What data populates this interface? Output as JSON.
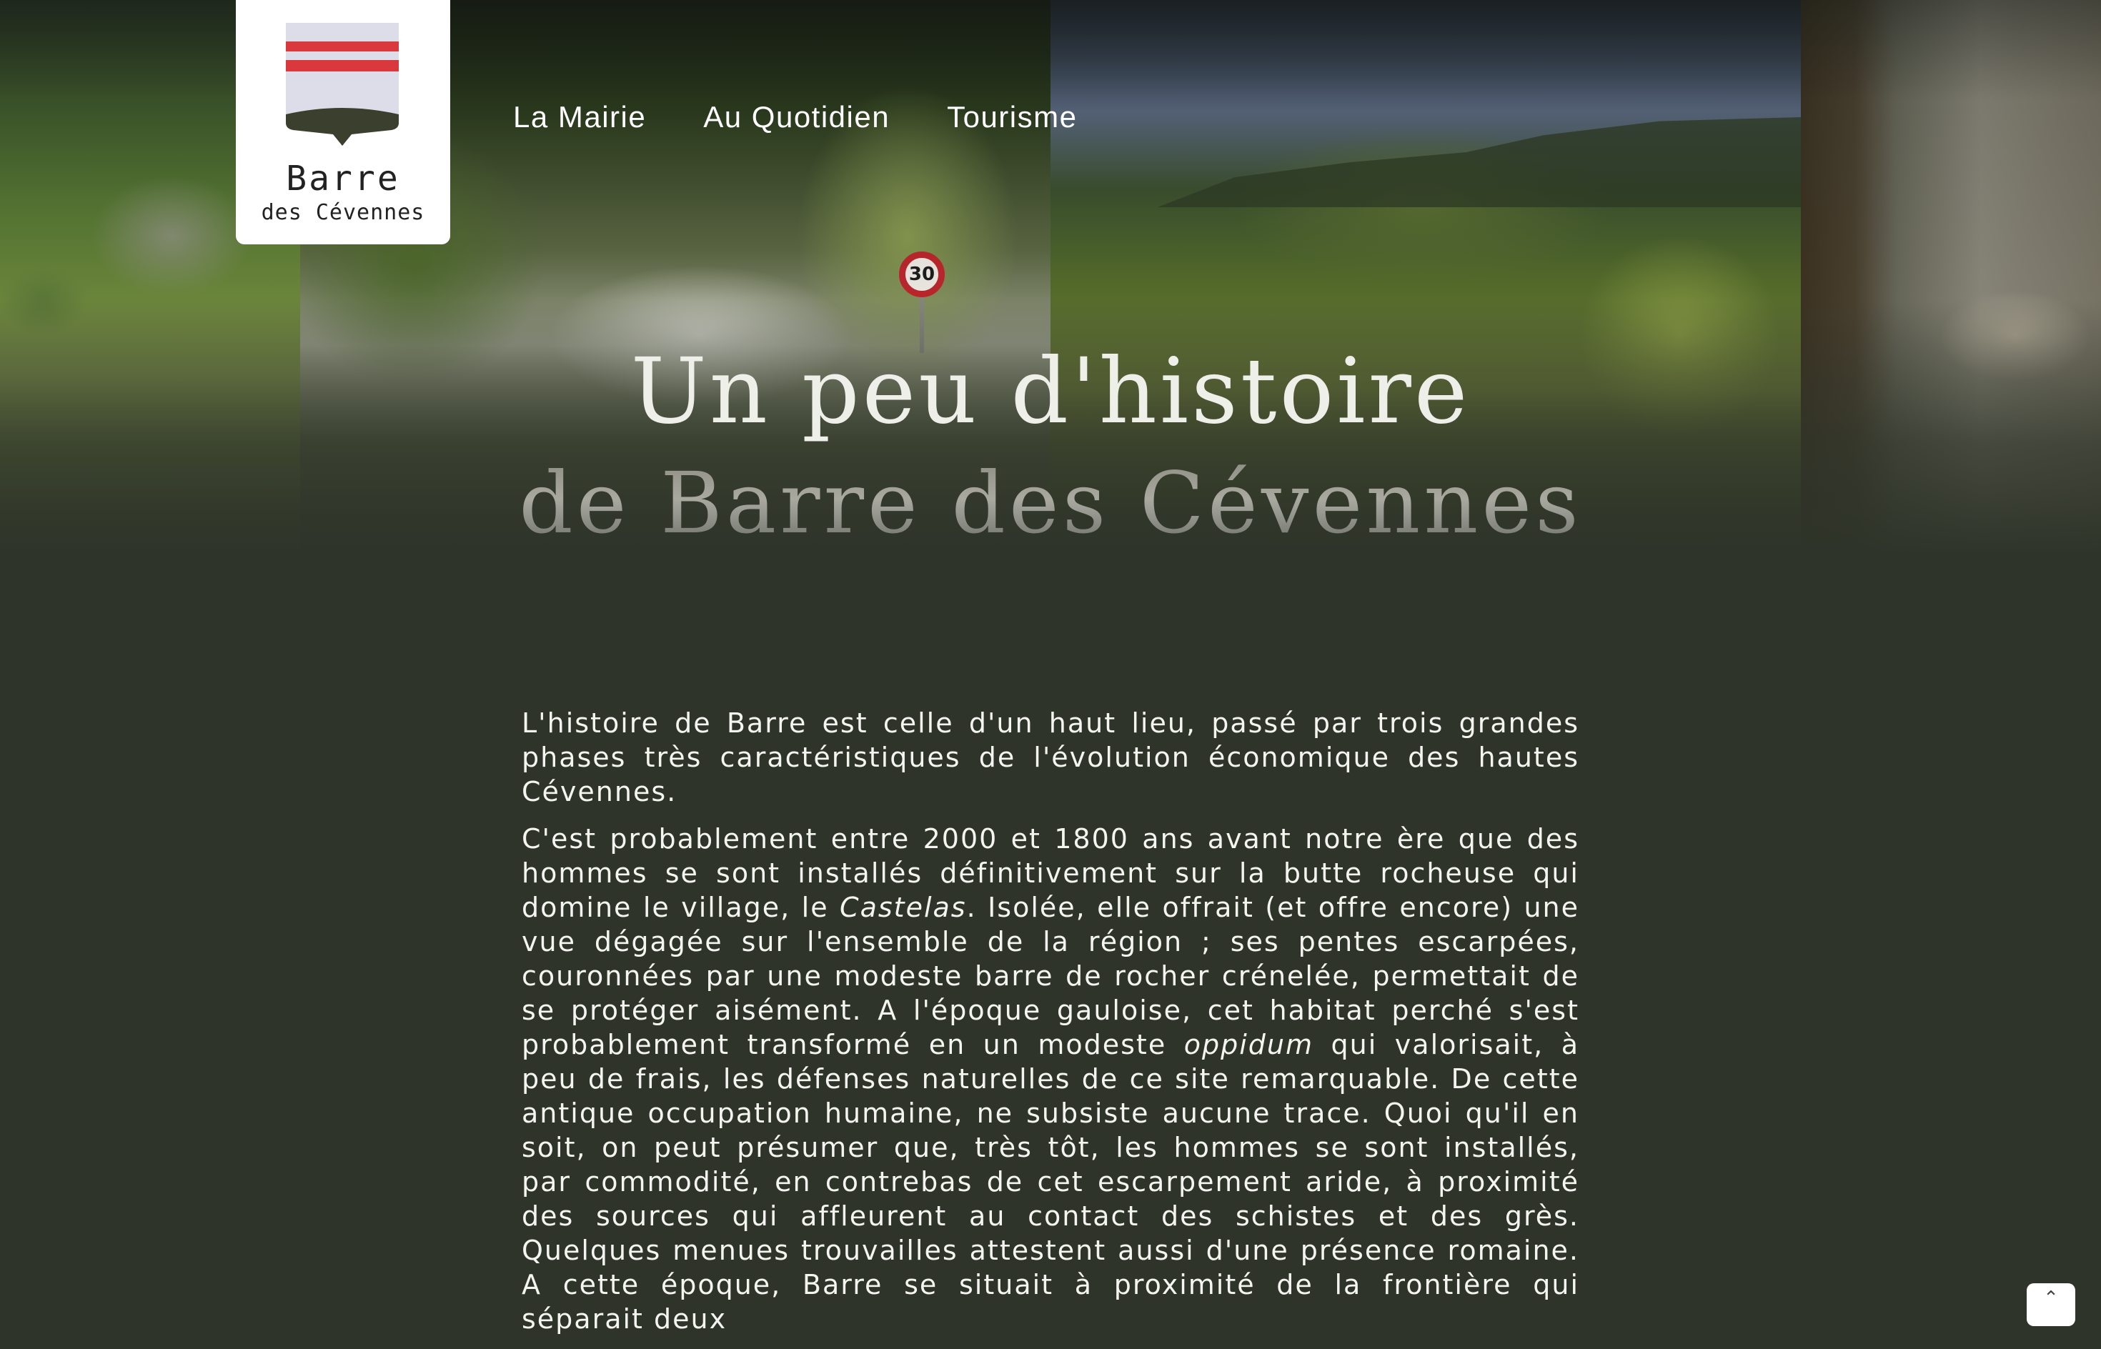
{
  "brand": {
    "name_line1": "Barre",
    "name_line2": "des Cévennes",
    "crest_colors": {
      "red": "#d9393d",
      "top": "#d2d6e6",
      "bottom": "#3b3f2d"
    }
  },
  "nav": {
    "items": [
      {
        "label": "La Mairie"
      },
      {
        "label": "Au Quotidien"
      },
      {
        "label": "Tourisme"
      }
    ]
  },
  "hero": {
    "title_line1": "Un peu d'histoire",
    "title_line2": "de Barre des Cévennes",
    "speed_sign": "30"
  },
  "article": {
    "p1": "L'histoire de Barre est celle d'un haut lieu, passé par trois grandes phases très caractéristiques de l'évolution économique des hautes Cévennes.",
    "p2_a": "C'est probablement entre 2000 et 1800 ans avant notre ère que des hommes se sont installés définitivement sur la butte rocheuse qui domine le village, le ",
    "p2_em1": "Castelas",
    "p2_b": ". Isolée, elle offrait (et offre encore) une vue dégagée sur l'ensemble de la région ; ses pentes escarpées, couronnées par une modeste barre de rocher crénelée, permettait de se protéger aisément. A l'époque gauloise, cet habitat perché s'est probablement transformé en un modeste ",
    "p2_em2": "oppidum",
    "p2_c": " qui valorisait, à peu de frais, les défenses naturelles de ce site remarquable. De cette antique occupation humaine, ne subsiste aucune trace. Quoi qu'il en soit, on peut présumer que, très tôt, les hommes se sont installés, par commodité, en contrebas de cet escarpement aride, à proximité des sources qui affleurent au contact des schistes et des grès. Quelques menues trouvailles attestent aussi d'une présence romaine. A cette époque, Barre se situait à proximité de la frontière qui séparait deux"
  },
  "scroll_top": {
    "icon": "chevron-up-icon",
    "glyph": "⌃"
  }
}
